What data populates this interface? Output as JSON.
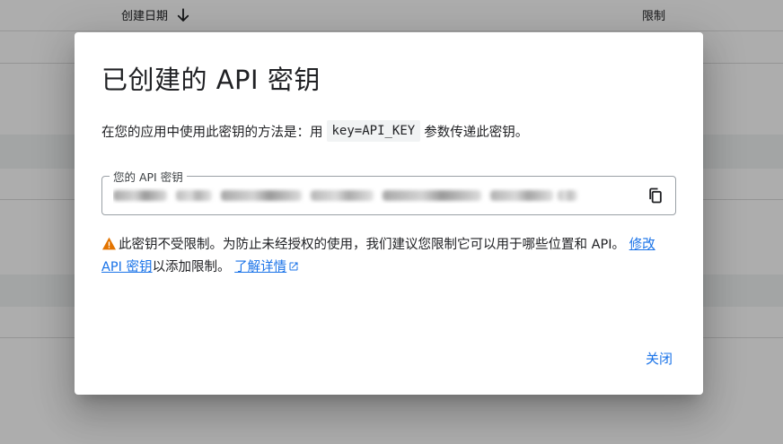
{
  "background": {
    "columns": {
      "created_date": "创建日期",
      "restriction": "限制"
    }
  },
  "dialog": {
    "title": "已创建的 API 密钥",
    "instructions": {
      "prefix": "在您的应用中使用此密钥的方法是：用",
      "code": "key=API_KEY",
      "suffix": "参数传递此密钥。"
    },
    "key_field": {
      "label": "您的 API 密钥",
      "value_redacted": true
    },
    "warning": {
      "text": "此密钥不受限制。为防止未经授权的使用，我们建议您限制它可以用于哪些位置和 API。",
      "edit_link": "修改 API 密钥",
      "after_edit": "以添加限制。",
      "learn_more": "了解详情"
    },
    "close_label": "关闭"
  },
  "colors": {
    "accent": "#1a73e8",
    "warning": "#e37400",
    "text": "#202124"
  },
  "icons": {
    "sort": "arrow-down-icon",
    "copy": "copy-icon",
    "warning": "warning-icon",
    "external": "open-in-new-icon"
  }
}
